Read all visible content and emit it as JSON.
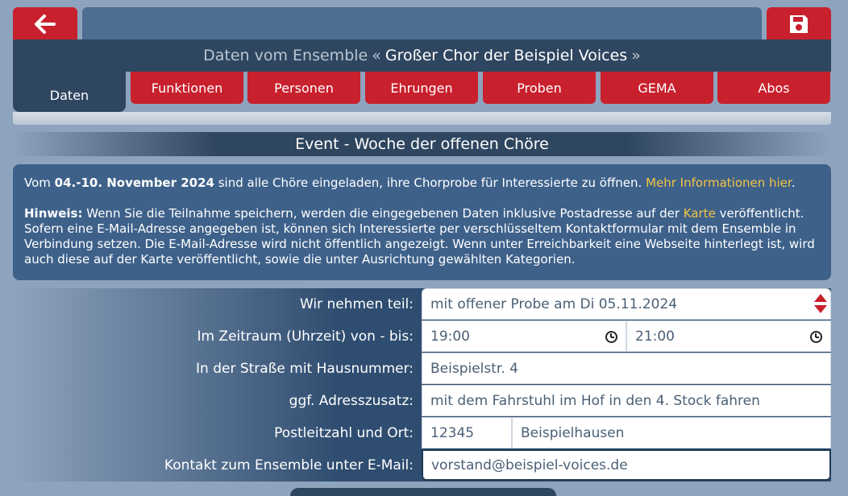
{
  "header": {
    "prefix": "Daten vom Ensemble",
    "open_quote": "«",
    "ensemble_name": "Großer Chor der Beispiel Voices",
    "close_quote": "»"
  },
  "tabs": [
    {
      "label": "Daten",
      "active": true
    },
    {
      "label": "Funktionen"
    },
    {
      "label": "Personen"
    },
    {
      "label": "Ehrungen"
    },
    {
      "label": "Proben"
    },
    {
      "label": "GEMA"
    },
    {
      "label": "Abos"
    }
  ],
  "section_title": "Event - Woche der offenen Chöre",
  "info": {
    "p1_pre": "Vom ",
    "p1_dates": "04.-10. November 2024",
    "p1_post": " sind alle Chöre eingeladen, ihre Chorprobe für Interessierte zu öffnen. ",
    "p1_link": "Mehr Informationen hier",
    "p1_end": ".",
    "p2_label": "Hinweis:",
    "p2_text1": " Wenn Sie die Teilnahme speichern, werden die eingegebenen Daten inklusive Postadresse auf der ",
    "p2_link": "Karte",
    "p2_text2": " veröffentlicht. Sofern eine E-Mail-Adresse angegeben ist, können sich Interessierte per verschlüsseltem Kontaktformular mit dem Ensemble in Verbindung setzen. Die E-Mail-Adresse wird nicht öffentlich angezeigt. Wenn unter Erreichbarkeit eine Webseite hinterlegt ist, wird auch diese auf der Karte veröffentlicht, sowie die unter Ausrichtung gewählten Kategorien."
  },
  "form": {
    "participation_label": "Wir nehmen teil:",
    "participation_value": "mit offener Probe am Di 05.11.2024",
    "time_label": "Im Zeitraum (Uhrzeit) von - bis:",
    "time_from": "19:00",
    "time_to": "21:00",
    "street_label": "In der Straße mit Hausnummer:",
    "street_value": "Beispielstr. 4",
    "addr_extra_label": "ggf. Adresszusatz:",
    "addr_extra_value": "mit dem Fahrstuhl im Hof in den 4. Stock fahren",
    "city_label": "Postleitzahl und Ort:",
    "zip_value": "12345",
    "city_value": "Beispielhausen",
    "email_label": "Kontakt zum Ensemble unter E-Mail:",
    "email_value": "vorstand@beispiel-voices.de"
  },
  "colors": {
    "accent_red": "#c8202d",
    "panel_dark": "#2f4660",
    "info_bg": "#3e618a",
    "link_yellow": "#f2c444"
  },
  "icons": {
    "back": "arrow-left-icon",
    "save": "floppy-disk-icon",
    "time": "clock-icon",
    "select": "up-down-arrows-icon"
  }
}
